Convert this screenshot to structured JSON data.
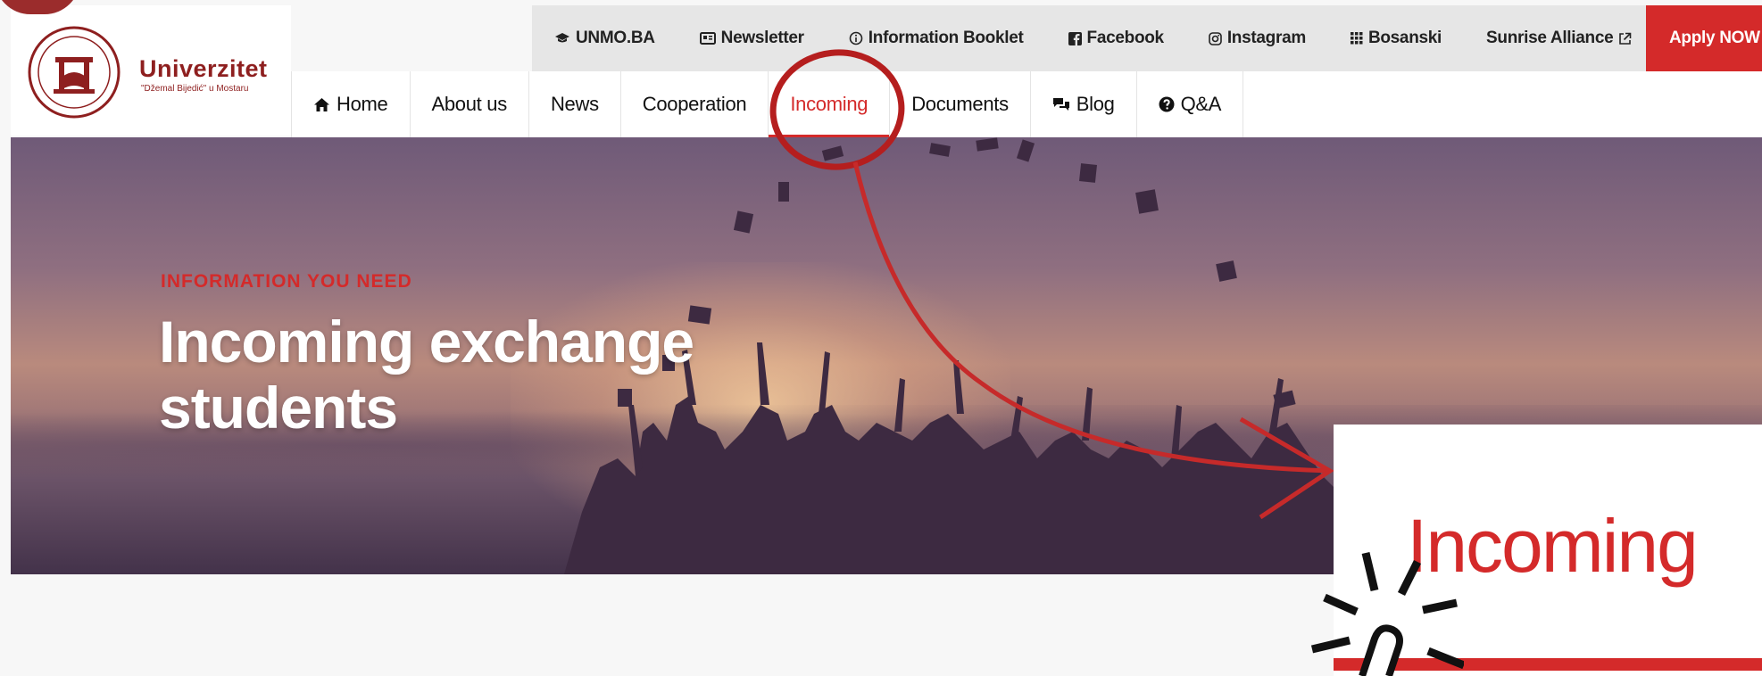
{
  "brand": {
    "name": "Univerzitet",
    "subtitle": "\"Džemal Bijedić\" u Mostaru",
    "accent_color": "#d42a2a",
    "logo_color": "#8e1f1f"
  },
  "top_bar": {
    "items": [
      {
        "label": "UNMO.BA",
        "icon": "graduation-cap-icon"
      },
      {
        "label": "Newsletter",
        "icon": "newspaper-icon"
      },
      {
        "label": "Information Booklet",
        "icon": "info-circle-icon"
      },
      {
        "label": "Facebook",
        "icon": "facebook-icon"
      },
      {
        "label": "Instagram",
        "icon": "instagram-icon"
      },
      {
        "label": "Bosanski",
        "icon": "grid-icon"
      },
      {
        "label": "Sunrise Alliance",
        "icon": "external-link-icon"
      }
    ],
    "apply_label": "Apply NOW"
  },
  "main_nav": {
    "items": [
      {
        "label": "Home",
        "icon": "home-icon"
      },
      {
        "label": "About us"
      },
      {
        "label": "News"
      },
      {
        "label": "Cooperation"
      },
      {
        "label": "Incoming",
        "active": true
      },
      {
        "label": "Documents"
      },
      {
        "label": "Blog",
        "icon": "comments-icon"
      },
      {
        "label": "Q&A",
        "icon": "question-circle-icon"
      }
    ]
  },
  "hero": {
    "eyebrow": "INFORMATION YOU NEED",
    "title": "Incoming exchange students"
  },
  "callout": {
    "zoom_label": "Incoming",
    "annotation_color": "#c62a2a"
  }
}
